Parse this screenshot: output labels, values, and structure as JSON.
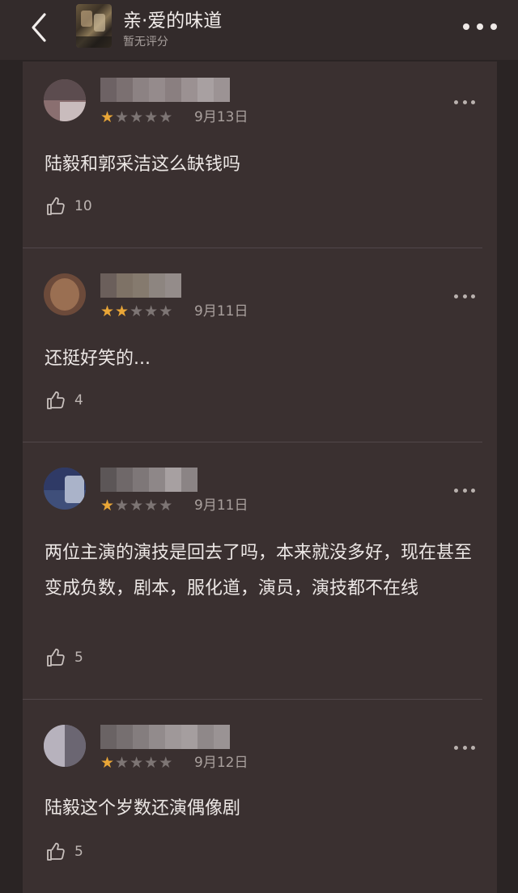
{
  "header": {
    "back_icon": "chevron-left-icon",
    "title": "亲·爱的味道",
    "rating_status": "暂无评分",
    "more_icon": "more-horizontal-icon"
  },
  "reviews": [
    {
      "rating": 1,
      "max_rating": 5,
      "date": "9月13日",
      "text": "陆毅和郭采洁这么缺钱吗",
      "likes": "10"
    },
    {
      "rating": 2,
      "max_rating": 5,
      "date": "9月11日",
      "text": "还挺好笑的...",
      "likes": "4"
    },
    {
      "rating": 1,
      "max_rating": 5,
      "date": "9月11日",
      "text": "两位主演的演技是回去了吗，本来就没多好，现在甚至变成负数，剧本，服化道，演员，演技都不在线",
      "likes": "5"
    },
    {
      "rating": 1,
      "max_rating": 5,
      "date": "9月12日",
      "text": "陆毅这个岁数还演偶像剧",
      "likes": "5"
    }
  ],
  "colors": {
    "star_on": "#e9a637",
    "star_off": "#7d7574",
    "background": "#2a2424",
    "panel": "#3a3030"
  }
}
